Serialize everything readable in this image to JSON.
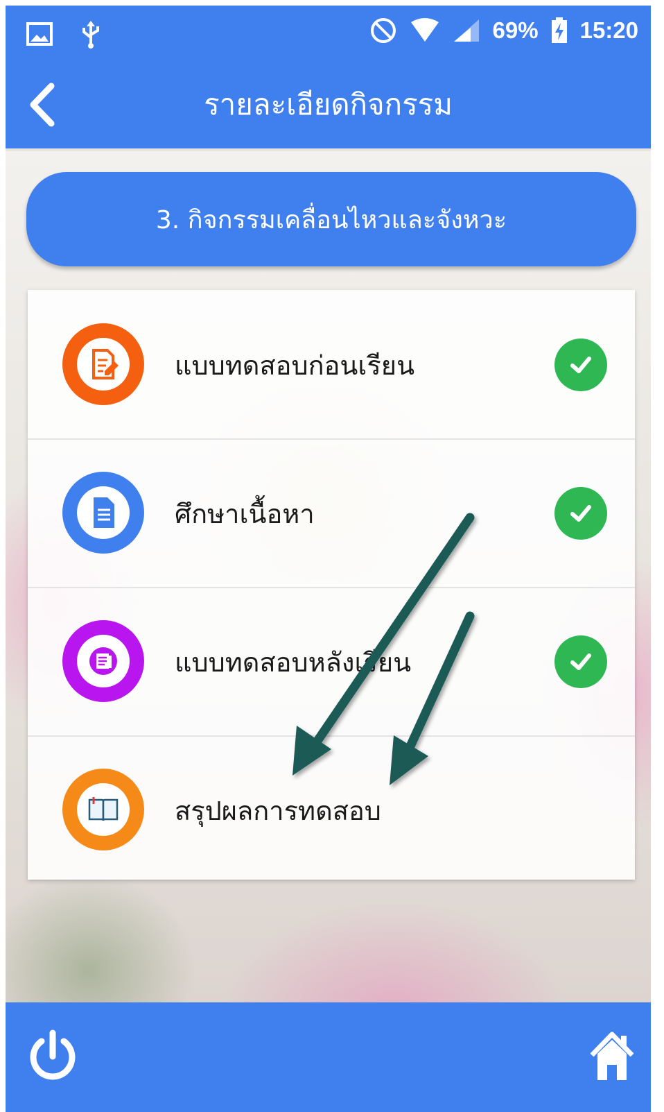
{
  "status_bar": {
    "battery": "69%",
    "time": "15:20"
  },
  "app_bar": {
    "title": "รายละเอียดกิจกรรม"
  },
  "section": {
    "title": "3. กิจกรรมเคลื่อนไหวและจังหวะ"
  },
  "activities": [
    {
      "label": "แบบทดสอบก่อนเรียน",
      "icon": "test-edit-icon",
      "color": "#f4600f",
      "completed": true
    },
    {
      "label": "ศึกษาเนื้อหา",
      "icon": "document-icon",
      "color": "#3f80ee",
      "completed": true
    },
    {
      "label": "แบบทดสอบหลังเรียน",
      "icon": "post-test-icon",
      "color": "#b916ef",
      "completed": true
    },
    {
      "label": "สรุปผลการทดสอบ",
      "icon": "open-book-icon",
      "color": "#f58a18",
      "completed": false
    }
  ],
  "colors": {
    "primary": "#3f80ee",
    "check": "#2fb753",
    "annotation_arrow": "#1f5a57"
  }
}
